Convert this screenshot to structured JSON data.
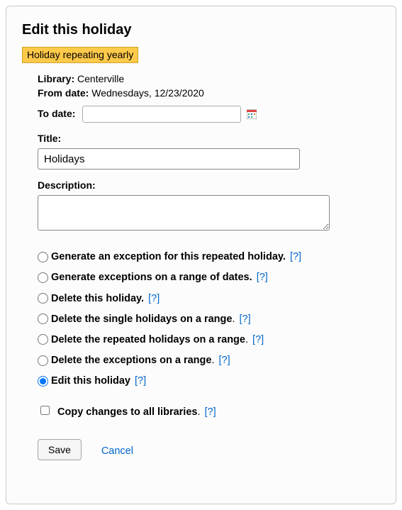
{
  "header": {
    "title": "Edit this holiday",
    "badge": "Holiday repeating yearly"
  },
  "info": {
    "library_label": "Library:",
    "library_value": "Centerville",
    "from_label": "From date:",
    "from_value": "Wednesdays, 12/23/2020",
    "to_label": "To date:",
    "to_value": ""
  },
  "fields": {
    "title_label": "Title:",
    "title_value": "Holidays",
    "description_label": "Description:",
    "description_value": ""
  },
  "options": [
    {
      "label": "Generate an exception for this repeated holiday.",
      "help": "[?]",
      "trailing_dot": false
    },
    {
      "label": "Generate exceptions on a range of dates.",
      "help": "[?]",
      "trailing_dot": false
    },
    {
      "label": "Delete this holiday.",
      "help": "[?]",
      "trailing_dot": false
    },
    {
      "label": "Delete the single holidays on a range",
      "help": "[?]",
      "trailing_dot": true
    },
    {
      "label": "Delete the repeated holidays on a range",
      "help": "[?]",
      "trailing_dot": true
    },
    {
      "label": "Delete the exceptions on a range",
      "help": "[?]",
      "trailing_dot": true
    },
    {
      "label": "Edit this holiday",
      "help": "[?]",
      "trailing_dot": false
    }
  ],
  "selected_option_index": 6,
  "copy": {
    "label": "Copy changes to all libraries",
    "help": "[?]"
  },
  "actions": {
    "save": "Save",
    "cancel": "Cancel"
  }
}
